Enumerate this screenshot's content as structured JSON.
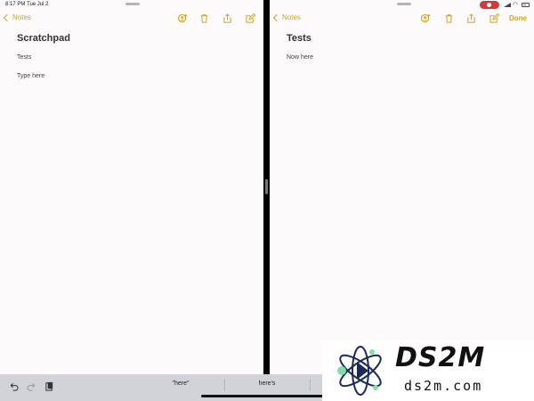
{
  "status_bar": {
    "time": "8:17 PM",
    "date": "Tue Jul 2"
  },
  "left_pane": {
    "back_label": "Notes",
    "title": "Scratchpad",
    "lines": [
      "Tests",
      "Type here"
    ]
  },
  "right_pane": {
    "back_label": "Notes",
    "done_label": "Done",
    "title": "Tests",
    "lines": [
      "Now here"
    ]
  },
  "shortcut_bar": {
    "suggestions": [
      "\"here\"",
      "here's"
    ]
  },
  "watermark": {
    "brand": "DS2M",
    "domain": "ds2m.com"
  },
  "colors": {
    "accent": "#d5a322",
    "paper": "#fcfafb",
    "keyboard": "#d1d3d8"
  },
  "icons": {
    "toolbar": [
      "add-people-icon",
      "trash-icon",
      "share-icon",
      "compose-icon"
    ],
    "shortcut": [
      "undo-icon",
      "redo-icon",
      "paste-icon"
    ]
  }
}
